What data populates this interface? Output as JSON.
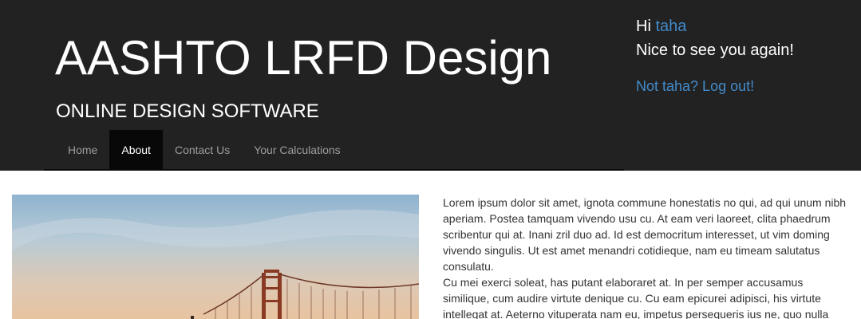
{
  "header": {
    "title": "AASHTO LRFD Design",
    "subtitle": "ONLINE DESIGN SOFTWARE"
  },
  "nav": {
    "items": [
      {
        "label": "Home",
        "active": false
      },
      {
        "label": "About",
        "active": true
      },
      {
        "label": "Contact Us",
        "active": false
      },
      {
        "label": "Your Calculations",
        "active": false
      }
    ]
  },
  "user_panel": {
    "greeting_prefix": "Hi ",
    "username": "taha",
    "welcome": "Nice to see you again!",
    "logout_label": "Not taha? Log out!"
  },
  "content": {
    "paragraph_1": "Lorem ipsum dolor sit amet, ignota commune honestatis no qui, ad qui unum nibh aperiam. Postea tamquam vivendo usu cu. At eam veri laoreet, clita phaedrum scribentur qui at. Inani zril duo ad. Id est democritum interesset, ut vim doming vivendo singulis. Ut est amet menandri cotidieque, nam eu timeam salutatus consulatu.",
    "paragraph_2": "Cu mei exerci soleat, has putant elaboraret at. In per semper accusamus similique, cum audire virtute denique cu. Cu eam epicurei adipisci, his virtute intellegat at. Aeterno vituperata nam eu, impetus persequeris ius ne, quo nulla"
  },
  "colors": {
    "header_bg": "#222222",
    "link": "#428bca",
    "nav_active_bg": "#080808"
  }
}
